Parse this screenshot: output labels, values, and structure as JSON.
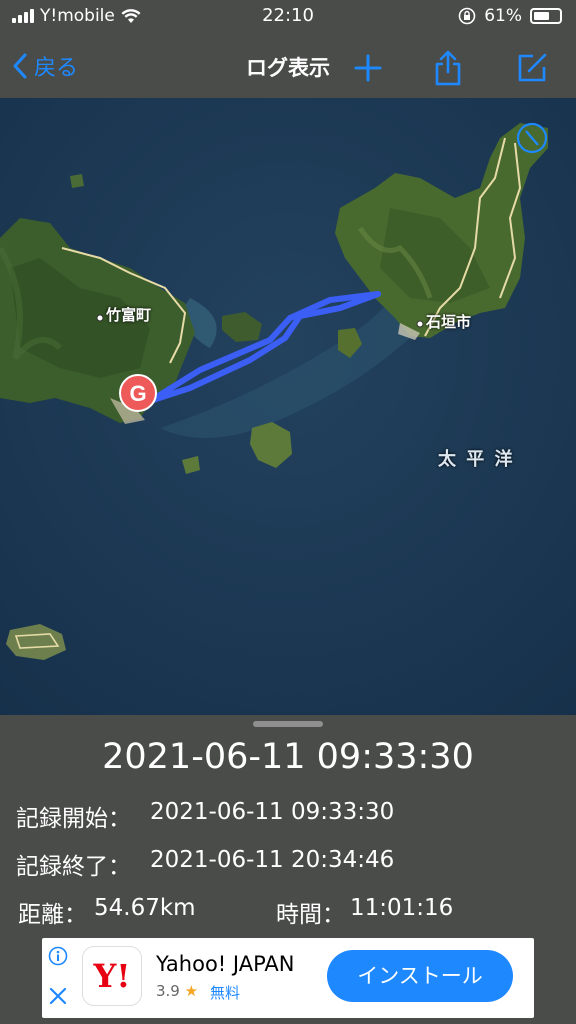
{
  "status": {
    "carrier": "Y!mobile",
    "time": "22:10",
    "battery": "61%",
    "battery_level": 0.61
  },
  "nav": {
    "back_label": "戻る",
    "title": "ログ表示",
    "accent": "#1e88ff"
  },
  "map": {
    "labels": {
      "taketomi": "竹富町",
      "ishigaki": "石垣市",
      "pacific": "太 平 洋"
    },
    "goal_marker": "G",
    "route_color": "#3b5ef5"
  },
  "log": {
    "header_datetime": "2021-06-11 09:33:30",
    "start_label": "記録開始：",
    "start_value": "2021-06-11 09:33:30",
    "end_label": "記録終了：",
    "end_value": "2021-06-11 20:34:46",
    "distance_label": "距離：",
    "distance_value": "54.67km",
    "duration_label": "時間：",
    "duration_value": "11:01:16"
  },
  "ad": {
    "app_name": "Yahoo! JAPAN",
    "rating": "3.9",
    "price": "無料",
    "install_label": "インストール",
    "logo_text": "Y!",
    "info_icon": "info-icon",
    "close_icon": "close-icon"
  }
}
